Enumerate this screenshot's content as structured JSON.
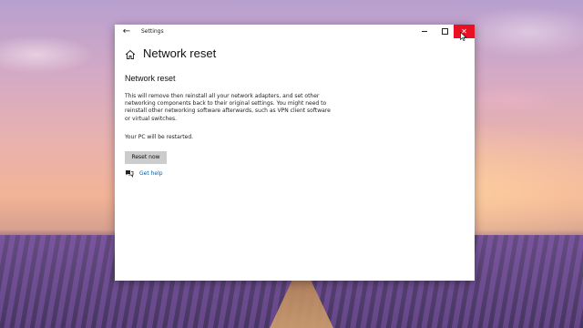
{
  "window": {
    "app_title": "Settings",
    "minimize_glyph": "",
    "close_glyph": "✕"
  },
  "header": {
    "home_icon": "home-icon",
    "page_title": "Network reset"
  },
  "content": {
    "section_title": "Network reset",
    "description": "This will remove then reinstall all your network adapters, and set other networking components back to their original settings. You might need to reinstall other networking software afterwards, such as VPN client software or virtual switches.",
    "restart_note": "Your PC will be restarted.",
    "reset_button_label": "Reset now",
    "help_link_label": "Get help"
  },
  "colors": {
    "close_button": "#e81123",
    "link": "#0063b1",
    "button_bg": "#cccccc"
  }
}
